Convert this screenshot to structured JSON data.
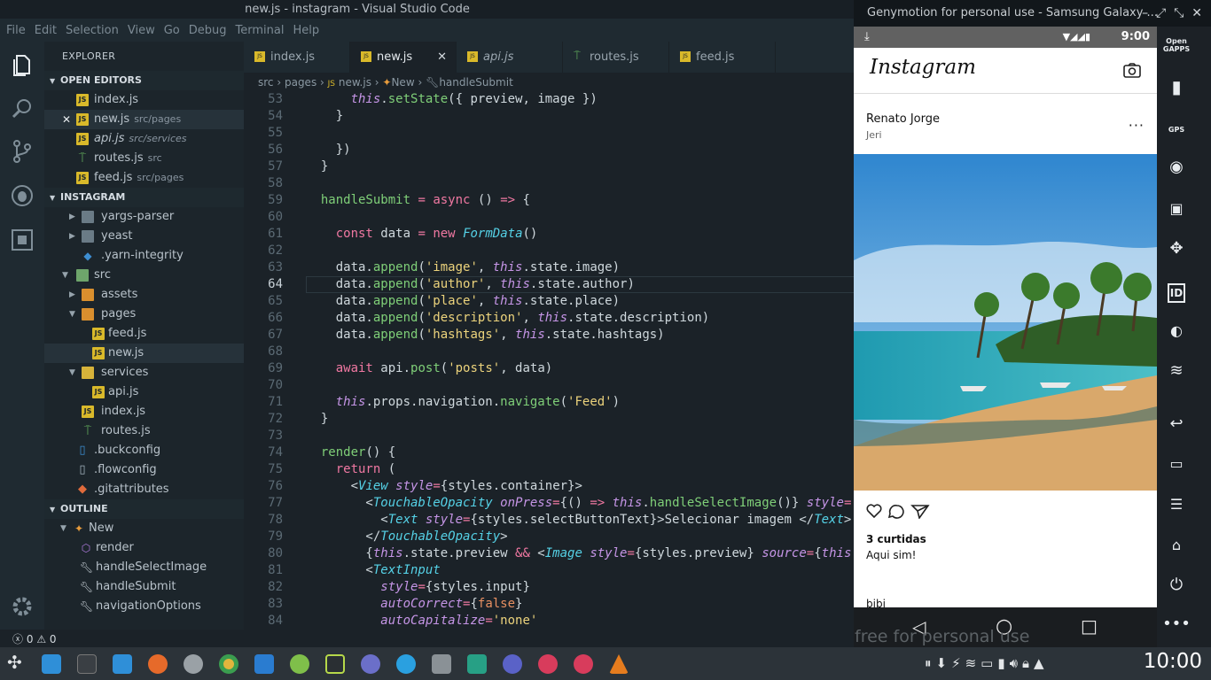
{
  "vscode": {
    "title": "new.js - instagram - Visual Studio Code",
    "menu": [
      "File",
      "Edit",
      "Selection",
      "View",
      "Go",
      "Debug",
      "Terminal",
      "Help"
    ],
    "explorer_title": "EXPLORER",
    "open_editors_label": "OPEN EDITORS",
    "open_editors": [
      {
        "name": "index.js",
        "hint": "",
        "type": "js"
      },
      {
        "name": "new.js",
        "hint": "src/pages",
        "type": "js"
      },
      {
        "name": "api.js",
        "hint": "src/services",
        "type": "js"
      },
      {
        "name": "routes.js",
        "hint": "src",
        "type": "route"
      },
      {
        "name": "feed.js",
        "hint": "src/pages",
        "type": "js"
      }
    ],
    "project_label": "INSTAGRAM",
    "tree": [
      {
        "name": "yargs-parser",
        "type": "folder"
      },
      {
        "name": "yeast",
        "type": "folder"
      },
      {
        "name": ".yarn-integrity",
        "type": "file"
      },
      {
        "name": "src",
        "type": "folder-open"
      },
      {
        "name": "assets",
        "type": "folder"
      },
      {
        "name": "pages",
        "type": "folder-open"
      },
      {
        "name": "feed.js",
        "type": "js"
      },
      {
        "name": "new.js",
        "type": "js"
      },
      {
        "name": "services",
        "type": "folder-open"
      },
      {
        "name": "api.js",
        "type": "js"
      },
      {
        "name": "index.js",
        "type": "js"
      },
      {
        "name": "routes.js",
        "type": "route"
      },
      {
        "name": ".buckconfig",
        "type": "file"
      },
      {
        "name": ".flowconfig",
        "type": "file"
      },
      {
        "name": ".gitattributes",
        "type": "git"
      }
    ],
    "outline_label": "OUTLINE",
    "outline": [
      {
        "name": "New",
        "type": "class"
      },
      {
        "name": "render",
        "type": "method"
      },
      {
        "name": "handleSelectImage",
        "type": "wrench"
      },
      {
        "name": "handleSubmit",
        "type": "wrench"
      },
      {
        "name": "navigationOptions",
        "type": "wrench"
      }
    ],
    "tabs": [
      {
        "name": "index.js",
        "type": "js"
      },
      {
        "name": "new.js",
        "type": "js"
      },
      {
        "name": "api.js",
        "type": "js"
      },
      {
        "name": "routes.js",
        "type": "route"
      },
      {
        "name": "feed.js",
        "type": "js"
      }
    ],
    "breadcrumb": [
      "src",
      "pages",
      "new.js",
      "New",
      "handleSubmit"
    ],
    "status": {
      "errors": "0",
      "warnings": "0"
    }
  },
  "emulator": {
    "title": "Genymotion for personal use - Samsung Galaxy ...",
    "time": "9:00",
    "app_name": "Instagram",
    "post": {
      "author": "Renato Jorge",
      "place": "Jeri",
      "likes": "3 curtidas",
      "description": "Aqui sim!",
      "hashtags": "bibi"
    },
    "watermark": "free for personal use",
    "side_labels": [
      "Open GAPPS",
      "GPS",
      "ID"
    ]
  },
  "taskbar": {
    "clock": "10:00"
  }
}
